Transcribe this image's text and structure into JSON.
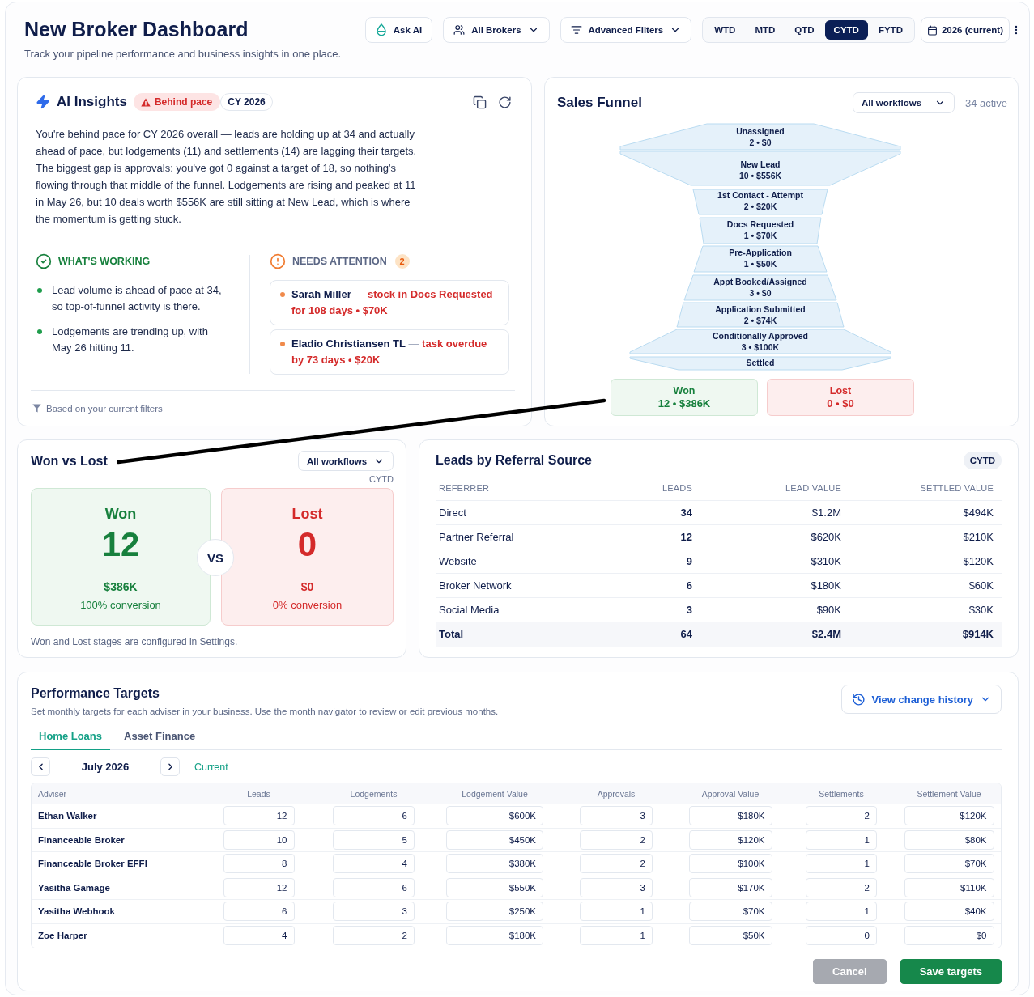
{
  "header": {
    "title": "New Broker Dashboard",
    "subtitle": "Track your pipeline performance and business insights in one place."
  },
  "toolbar": {
    "ask_ai": "Ask AI",
    "brokers": "All Brokers",
    "filters": "Advanced Filters",
    "periods": [
      {
        "label": "WTD",
        "selected": false
      },
      {
        "label": "MTD",
        "selected": false
      },
      {
        "label": "QTD",
        "selected": false
      },
      {
        "label": "CYTD",
        "selected": true
      },
      {
        "label": "FYTD",
        "selected": false
      }
    ],
    "year": "2026 (current)"
  },
  "ai_insights": {
    "title": "AI Insights",
    "status_badge": "Behind pace",
    "period_badge": "CY 2026",
    "summary": "You're behind pace for CY 2026 overall — leads are holding up at 34 and actually ahead of pace, but lodgements (11) and settlements (14) are lagging their targets. The biggest gap is approvals: you've got 0 against a target of 18, so nothing's flowing through that middle of the funnel. Lodgements are rising and peaked at 11 in May 26, but 10 deals worth $556K are still sitting at New Lead, which is where the momentum is getting stuck.",
    "working": {
      "heading": "WHAT'S WORKING",
      "items": [
        "Lead volume is ahead of pace at 34, so top-of-funnel activity is there.",
        "Lodgements are trending up, with May 26 hitting 11."
      ]
    },
    "attention": {
      "heading": "NEEDS ATTENTION",
      "count": "2",
      "items": [
        {
          "name": "Sarah Miller",
          "separator": "—",
          "detail": "stock in Docs Requested for 108 days • $70K"
        },
        {
          "name": "Eladio Christiansen TL",
          "separator": "—",
          "detail": "task overdue by 73 days • $20K"
        }
      ]
    },
    "footer": "Based on your current filters"
  },
  "sales_funnel": {
    "title": "Sales Funnel",
    "workflow_select": "All workflows",
    "active_count": "34 active",
    "stages": [
      {
        "name": "Unassigned",
        "summary": "2 • $0"
      },
      {
        "name": "New Lead",
        "summary": "10 • $556K"
      },
      {
        "name": "1st Contact - Attempt",
        "summary": "2 • $20K"
      },
      {
        "name": "Docs Requested",
        "summary": "1 • $70K"
      },
      {
        "name": "Pre-Application",
        "summary": "1 • $50K"
      },
      {
        "name": "Appt Booked/Assigned",
        "summary": "3 • $0"
      },
      {
        "name": "Application Submitted",
        "summary": "2 • $74K"
      },
      {
        "name": "Conditionally Approved",
        "summary": "3 • $100K"
      },
      {
        "name": "Settled"
      }
    ],
    "outcomes": [
      {
        "kind": "won",
        "label": "Won",
        "summary": "12 • $386K"
      },
      {
        "kind": "lost",
        "label": "Lost",
        "summary": "0 • $0"
      }
    ]
  },
  "won_vs_lost": {
    "title": "Won vs Lost",
    "workflow_select": "All workflows",
    "period": "CYTD",
    "outcomes": [
      {
        "kind": "won",
        "label": "Won",
        "count": "12",
        "value": "$386K",
        "conversion": "100% conversion"
      },
      {
        "kind": "lost",
        "label": "Lost",
        "count": "0",
        "value": "$0",
        "conversion": "0% conversion"
      }
    ],
    "divider_label": "VS",
    "footnote": "Won and Lost stages are configured in Settings."
  },
  "referral_sources": {
    "title": "Leads by Referral Source",
    "period": "CYTD",
    "columns": [
      "REFERRER",
      "LEADS",
      "LEAD VALUE",
      "SETTLED VALUE"
    ],
    "rows": [
      [
        "Direct",
        "34",
        "$1.2M",
        "$494K"
      ],
      [
        "Partner Referral",
        "12",
        "$620K",
        "$210K"
      ],
      [
        "Website",
        "9",
        "$310K",
        "$120K"
      ],
      [
        "Broker Network",
        "6",
        "$180K",
        "$60K"
      ],
      [
        "Social Media",
        "3",
        "$90K",
        "$30K"
      ]
    ],
    "total": [
      "Total",
      "64",
      "$2.4M",
      "$914K"
    ]
  },
  "performance_targets": {
    "title": "Performance Targets",
    "subtitle": "Set monthly targets for each adviser in your business. Use the month navigator to review or edit previous months.",
    "history_button": "View change history",
    "tabs": [
      {
        "label": "Home Loans",
        "selected": true
      },
      {
        "label": "Asset Finance",
        "selected": false
      }
    ],
    "month": "July 2026",
    "month_status": "Current",
    "columns": [
      "Adviser",
      "Leads",
      "Lodgements",
      "Lodgement Value",
      "Approvals",
      "Approval Value",
      "Settlements",
      "Settlement Value"
    ],
    "rows": [
      {
        "adviser": "Ethan Walker",
        "values": [
          "12",
          "6",
          "$600K",
          "3",
          "$180K",
          "2",
          "$120K"
        ]
      },
      {
        "adviser": "Financeable Broker",
        "values": [
          "10",
          "5",
          "$450K",
          "2",
          "$120K",
          "1",
          "$80K"
        ]
      },
      {
        "adviser": "Financeable Broker EFFI",
        "values": [
          "8",
          "4",
          "$380K",
          "2",
          "$100K",
          "1",
          "$70K"
        ]
      },
      {
        "adviser": "Yasitha Gamage",
        "values": [
          "12",
          "6",
          "$550K",
          "3",
          "$170K",
          "2",
          "$110K"
        ]
      },
      {
        "adviser": "Yasitha Webhook",
        "values": [
          "6",
          "3",
          "$250K",
          "1",
          "$70K",
          "1",
          "$40K"
        ]
      },
      {
        "adviser": "Zoe Harper",
        "values": [
          "4",
          "2",
          "$180K",
          "1",
          "$50K",
          "0",
          "$0"
        ]
      }
    ],
    "actions": [
      {
        "kind": "cancel",
        "label": "Cancel",
        "disabled": true
      },
      {
        "kind": "save",
        "label": "Save targets",
        "disabled": false
      }
    ]
  }
}
